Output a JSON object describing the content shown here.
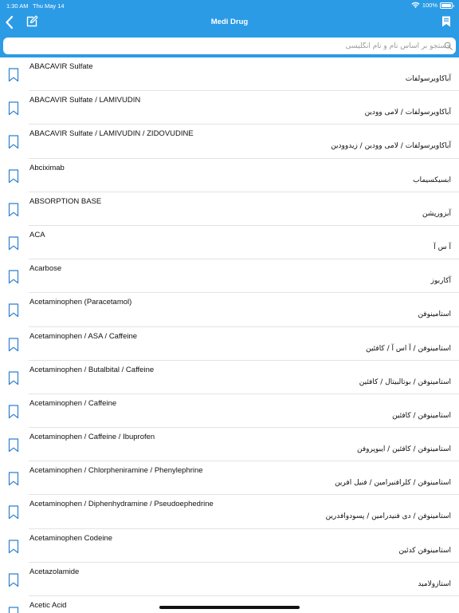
{
  "status_bar": {
    "time": "1:30 AM",
    "date": "Thu May 14",
    "battery": "100%"
  },
  "nav": {
    "title": "Medi Drug"
  },
  "search": {
    "placeholder": "جستجو بر اساس نام و نام انگلیسی"
  },
  "colors": {
    "accent": "#2b9be6",
    "icon": "#2d7fd0",
    "separator": "#e3e3e6"
  },
  "drugs": [
    {
      "en": "ABACAVIR Sulfate",
      "fa": "آباکاویرسولفات"
    },
    {
      "en": "ABACAVIR Sulfate / LAMIVUDIN",
      "fa": "آباکاویرسولفات / لامی وودین"
    },
    {
      "en": "ABACAVIR Sulfate / LAMIVUDIN / ZIDOVUDINE",
      "fa": "آباکاویرسولفات / لامی وودین / زیدوودین"
    },
    {
      "en": "Abciximab",
      "fa": "ابسیکسیماب"
    },
    {
      "en": "ABSORPTION BASE",
      "fa": "آبزورپشن"
    },
    {
      "en": "ACA",
      "fa": "آ س آ"
    },
    {
      "en": "Acarbose",
      "fa": "آکاربوز"
    },
    {
      "en": "Acetaminophen (Paracetamol)",
      "fa": "استامینوفن"
    },
    {
      "en": "Acetaminophen / ASA / Caffeine",
      "fa": "استامینوفن / آ اس آ / کافئین"
    },
    {
      "en": "Acetaminophen / Butalbital / Caffeine",
      "fa": "استامینوفن / بوتالبیتال / کافئین"
    },
    {
      "en": "Acetaminophen / Caffeine",
      "fa": "استامینوفن / کافئین"
    },
    {
      "en": "Acetaminophen / Caffeine / Ibuprofen",
      "fa": "استامینوفن / کافئین / ایبوپروفن"
    },
    {
      "en": "Acetaminophen / Chlorpheniramine / Phenylephrine",
      "fa": "استامینوفن / کلرافنیرامین / فنیل افرین"
    },
    {
      "en": "Acetaminophen / Diphenhydramine / Pseudoephedrine",
      "fa": "استامینوفن / دی فنیدرامین / پسودوافدرین"
    },
    {
      "en": "Acetaminophen Codeine",
      "fa": "استامینوفن کدئین"
    },
    {
      "en": "Acetazolamide",
      "fa": "استازولامید"
    },
    {
      "en": "Acetic Acid",
      "fa": ""
    }
  ]
}
